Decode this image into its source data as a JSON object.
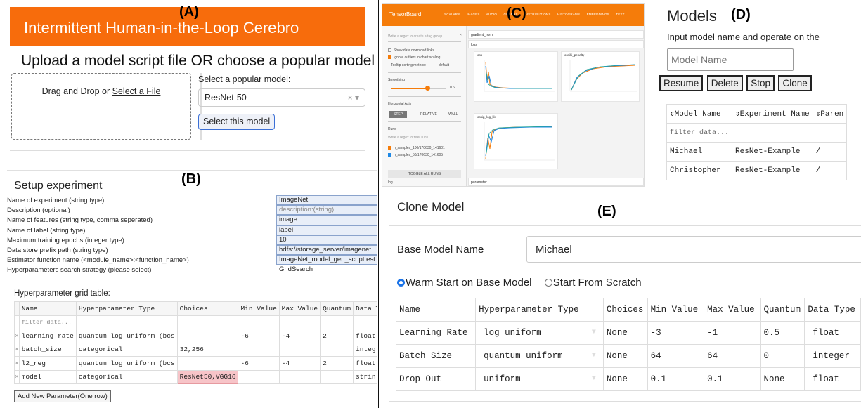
{
  "panel_labels": {
    "a": "(A)",
    "b": "(B)",
    "c": "(C)",
    "d": "(D)",
    "e": "(E)"
  },
  "panel_a": {
    "banner_title": "Intermittent Human-in-the-Loop Cerebro",
    "heading": "Upload a model script file OR choose a popular model",
    "drop_text": "Drag and Drop or ",
    "drop_link": "Select a File",
    "select_label": "Select a popular model:",
    "selected_model": "ResNet-50",
    "select_controls": "× ▾",
    "select_button": "Select this model"
  },
  "panel_b": {
    "title": "Setup experiment",
    "fields": [
      {
        "label": "Name of experiment (string type)",
        "value": "ImageNet",
        "kind": "filled"
      },
      {
        "label": "Description (optional)",
        "value": "description:(string)",
        "kind": "placeholder"
      },
      {
        "label": "Name of features (string type, comma seperated)",
        "value": "image",
        "kind": "filled"
      },
      {
        "label": "Name of label (string type)",
        "value": "label",
        "kind": "filled"
      },
      {
        "label": "Maximum training epochs (integer type)",
        "value": "10",
        "kind": "filled"
      },
      {
        "label": "Data store prefix path (string type)",
        "value": "hdfs://storage_server/imagenet",
        "kind": "filled"
      },
      {
        "label": "Estimator function name (<module_name>:<function_name>)",
        "value": "ImageNet_model_gen_script:est",
        "kind": "filled"
      },
      {
        "label": "Hyperparameters search strategy (please select)",
        "value": "GridSearch",
        "kind": "plain"
      }
    ],
    "grid_title": "Hyperparameter grid table:",
    "columns": [
      "Name",
      "Hyperparameter Type",
      "Choices",
      "Min Value",
      "Max Value",
      "Quantum",
      "Data T"
    ],
    "filter_placeholder": "filter data...",
    "remove_glyph": "×",
    "rows": [
      {
        "name": "learning_rate",
        "type": "quantum log uniform (bcs",
        "choices": "",
        "min": "-6",
        "max": "-4",
        "quantum": "2",
        "dtype": "float"
      },
      {
        "name": "batch_size",
        "type": "categorical",
        "choices": "32,256",
        "min": "",
        "max": "",
        "quantum": "",
        "dtype": "integ"
      },
      {
        "name": "l2_reg",
        "type": "quantum log uniform (bcs",
        "choices": "",
        "min": "-6",
        "max": "-4",
        "quantum": "2",
        "dtype": "float"
      },
      {
        "name": "model",
        "type": "categorical",
        "choices": "ResNet50,VGG16",
        "min": "",
        "max": "",
        "quantum": "",
        "dtype": "strin"
      }
    ],
    "add_button": "Add New Parameter(One row)"
  },
  "panel_c": {
    "brand": "TensorBoard",
    "tabs": [
      "SCALARS",
      "IMAGES",
      "AUDIO",
      "GRAPHS",
      "DISTRIBUTIONS",
      "HISTOGRAMS",
      "EMBEDDINGS",
      "TEXT"
    ],
    "search_placeholder": "Write a regex to create a tag group",
    "options": [
      "Show data download links",
      "Ignore outliers in chart scaling"
    ],
    "tooltip_label": "Tooltip sorting method:",
    "tooltip_value": "default",
    "smoothing_label": "Smoothing",
    "smoothing_value": "0.6",
    "horizontal_axis_label": "Horizontal Axis",
    "axis_options": [
      "STEP",
      "RELATIVE",
      "WALL"
    ],
    "runs_label": "Runs",
    "runs_filter_placeholder": "Write a regex to filter runs",
    "runs": [
      "n_samples_100/170630_141601",
      "n_samples_50/170630_141605"
    ],
    "toggle_all": "TOGGLE ALL RUNS",
    "log_dir": "log",
    "sections": [
      "gradient_norm",
      "loss",
      "parameter"
    ],
    "charts": [
      "loss",
      "lossiki_penalty",
      "lossip_log_lik"
    ],
    "series_colors": [
      "#f57c0a",
      "#1e88e5",
      "#26a69a"
    ]
  },
  "panel_d": {
    "title": "Models",
    "subtitle": "Input model name and operate on the",
    "input_placeholder": "Model Name",
    "buttons": [
      "Resume",
      "Delete",
      "Stop",
      "Clone"
    ],
    "columns": [
      "⇕Model Name",
      "⇕Experiment Name",
      "⇕Paren"
    ],
    "filter_placeholder": "filter data...",
    "rows": [
      {
        "model": "Michael",
        "experiment": "ResNet-Example",
        "parent": "/"
      },
      {
        "model": "Christopher",
        "experiment": "ResNet-Example",
        "parent": "/"
      }
    ]
  },
  "panel_e": {
    "title": "Clone Model",
    "base_label": "Base Model Name",
    "base_value": "Michael",
    "radio_warm": "Warm Start on Base Model",
    "radio_scratch": "Start From Scratch",
    "columns": [
      "Name",
      "Hyperparameter Type",
      "Choices",
      "Min Value",
      "Max Value",
      "Quantum",
      "Data Type"
    ],
    "rows": [
      {
        "name": "Learning Rate",
        "type": "log uniform",
        "choices": "None",
        "min": "-3",
        "max": "-1",
        "quantum": "0.5",
        "dtype": "float"
      },
      {
        "name": "Batch Size",
        "type": "quantum uniform",
        "choices": "None",
        "min": "64",
        "max": "64",
        "quantum": "0",
        "dtype": "integer"
      },
      {
        "name": "Drop Out",
        "type": "uniform",
        "choices": "None",
        "min": "0.1",
        "max": "0.1",
        "quantum": "None",
        "dtype": "float"
      }
    ]
  }
}
